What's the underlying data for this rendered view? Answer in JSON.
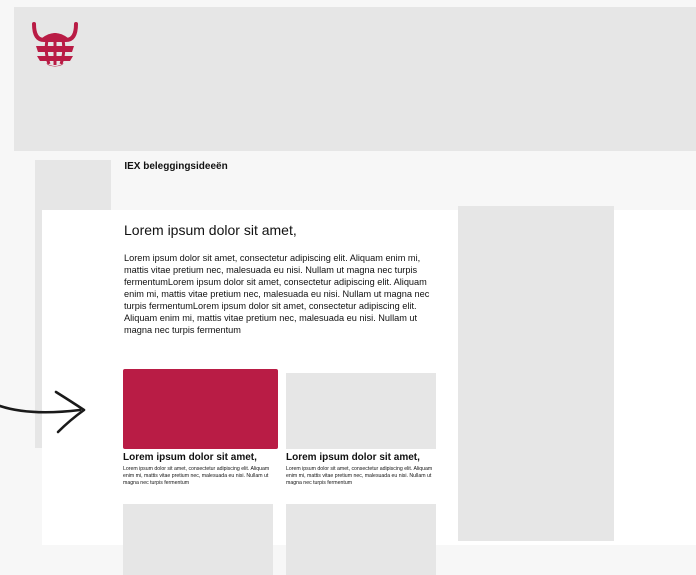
{
  "colors": {
    "accent": "#b91c45",
    "placeholder": "#e6e6e6",
    "background": "#f7f7f7",
    "text": "#111111"
  },
  "header": {
    "logo_icon": "globe-horns-icon"
  },
  "section": {
    "title": "IEX beleggingsideeën"
  },
  "article": {
    "heading": "Lorem ipsum dolor sit amet,",
    "body": "Lorem ipsum dolor sit amet, consectetur adipiscing elit. Aliquam enim mi, mattis vitae pretium nec, malesuada eu nisi. Nullam ut magna nec turpis fermentumLorem ipsum dolor sit amet, consectetur adipiscing elit. Aliquam enim mi, mattis vitae pretium nec, malesuada eu nisi. Nullam ut magna nec turpis fermentumLorem ipsum dolor sit amet, consectetur adipiscing elit. Aliquam enim mi, mattis vitae pretium nec, malesuada eu nisi. Nullam ut magna nec turpis fermentum"
  },
  "cards": [
    {
      "title": "Lorem ipsum dolor sit amet,",
      "description": "Lorem ipsum dolor sit amet, consectetur adipiscing elit. Aliquam enim mi, mattis vitae pretium nec, malesuada eu nisi. Nullam ut magna nec turpis fermentum"
    },
    {
      "title": "Lorem ipsum dolor sit amet,",
      "description": "Lorem ipsum dolor sit amet, consectetur adipiscing elit. Aliquam enim mi, mattis vitae pretium nec, malesuada eu nisi. Nullam ut magna nec turpis fermentum"
    }
  ],
  "annotation": {
    "arrow_icon": "hand-drawn-arrow-icon"
  }
}
